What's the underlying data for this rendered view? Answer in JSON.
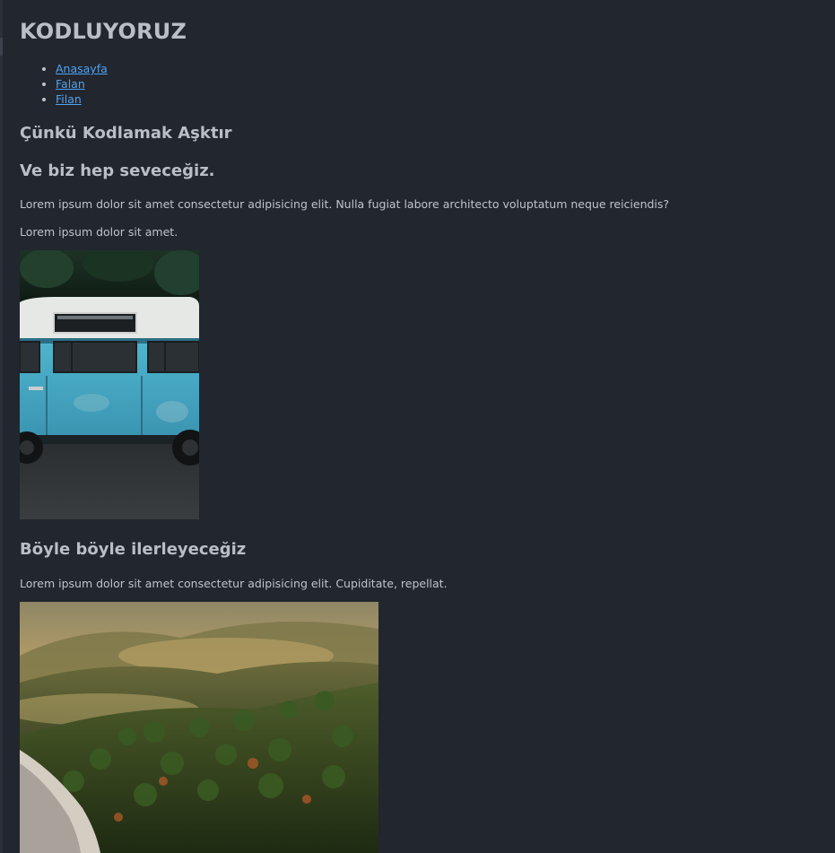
{
  "header": {
    "title": "KODLUYORUZ"
  },
  "nav": {
    "items": [
      {
        "label": "Anasayfa"
      },
      {
        "label": "Falan"
      },
      {
        "label": "Filan"
      }
    ]
  },
  "content": {
    "heading_love": "Çünkü Kodlamak Aşktır",
    "heading_always": "Ve biz hep seveceğiz.",
    "paragraph_1": "Lorem ipsum dolor sit amet consectetur adipisicing elit. Nulla fugiat labore architecto voluptatum neque reiciendis?",
    "paragraph_2": "Lorem ipsum dolor sit amet.",
    "heading_progress": "Böyle böyle ilerleyeceğiz",
    "paragraph_3": "Lorem ipsum dolor sit amet consectetur adipisicing elit. Cupiditate, repellat."
  },
  "colors": {
    "background": "#22262e",
    "text": "#bfc3cb",
    "link": "#4fa3f0"
  }
}
